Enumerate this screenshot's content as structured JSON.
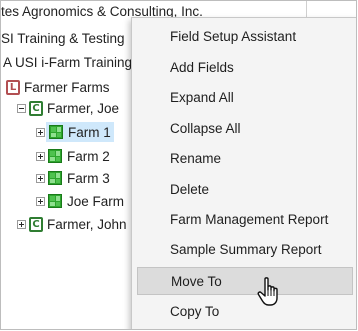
{
  "tree": {
    "org_line": "tes Agronomics & Consulting, Inc.",
    "training_line": "SI Training & Testing",
    "farm_training_line": "A USI i-Farm Training",
    "level_farmer_farms": {
      "badge": "L",
      "label": "Farmer Farms"
    },
    "client_joe": {
      "badge": "C",
      "label": "Farmer, Joe"
    },
    "farms": [
      {
        "label": "Farm 1",
        "icon": "farm-grid-icon"
      },
      {
        "label": "Farm 2",
        "icon": "farm-grid-icon"
      },
      {
        "label": "Farm 3",
        "icon": "farm-grid-icon"
      },
      {
        "label": "Joe Farm",
        "icon": "farm-grid-icon"
      }
    ],
    "client_john": {
      "badge": "C",
      "label": "Farmer, John"
    }
  },
  "context_menu": {
    "items": [
      {
        "label": "Field Setup Assistant"
      },
      {
        "label": "Add Fields"
      },
      {
        "label": "Expand All"
      },
      {
        "label": "Collapse All"
      },
      {
        "label": "Rename"
      },
      {
        "label": "Delete"
      },
      {
        "label": "Farm Management Report"
      },
      {
        "label": "Sample Summary Report"
      },
      {
        "label": "Move To"
      },
      {
        "label": "Copy To"
      }
    ],
    "hovered_item": "Move To"
  },
  "colors": {
    "selection": "#cfe8fb",
    "menu_background": "#f4f4f4",
    "menu_hover": "#dcdcdc",
    "level_badge": "#b24f52",
    "client_badge": "#2f7d32",
    "farm_icon": "#2ea52e"
  },
  "cursor": {
    "icon": "hand-pointer-icon"
  }
}
